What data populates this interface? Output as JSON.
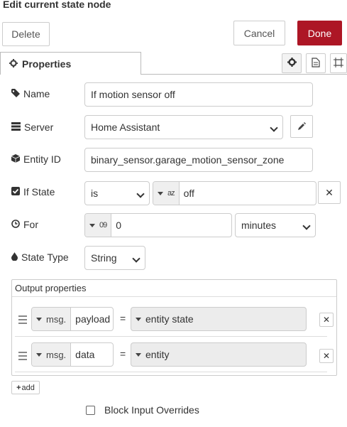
{
  "header": {
    "title": "Edit current state node",
    "delete_label": "Delete",
    "cancel_label": "Cancel",
    "done_label": "Done"
  },
  "tabs": {
    "properties_label": "Properties"
  },
  "form": {
    "name_label": "Name",
    "name_value": "If motion sensor off",
    "server_label": "Server",
    "server_value": "Home Assistant",
    "entity_label": "Entity ID",
    "entity_value": "binary_sensor.garage_motion_sensor_zone",
    "ifstate_label": "If State",
    "ifstate_operator": "is",
    "ifstate_type_glyph": "az",
    "ifstate_value": "off",
    "for_label": "For",
    "for_type_glyph": "09",
    "for_value": "0",
    "for_unit": "minutes",
    "statetype_label": "State Type",
    "statetype_value": "String"
  },
  "output": {
    "title": "Output properties",
    "rows": [
      {
        "prefix": "msg.",
        "property": "payload",
        "equals": "=",
        "value": "entity state"
      },
      {
        "prefix": "msg.",
        "property": "data",
        "equals": "=",
        "value": "entity"
      }
    ],
    "add_label": "add"
  },
  "block_input": {
    "label": "Block Input Overrides",
    "checked": false
  },
  "colors": {
    "primary": "#ad1625"
  }
}
